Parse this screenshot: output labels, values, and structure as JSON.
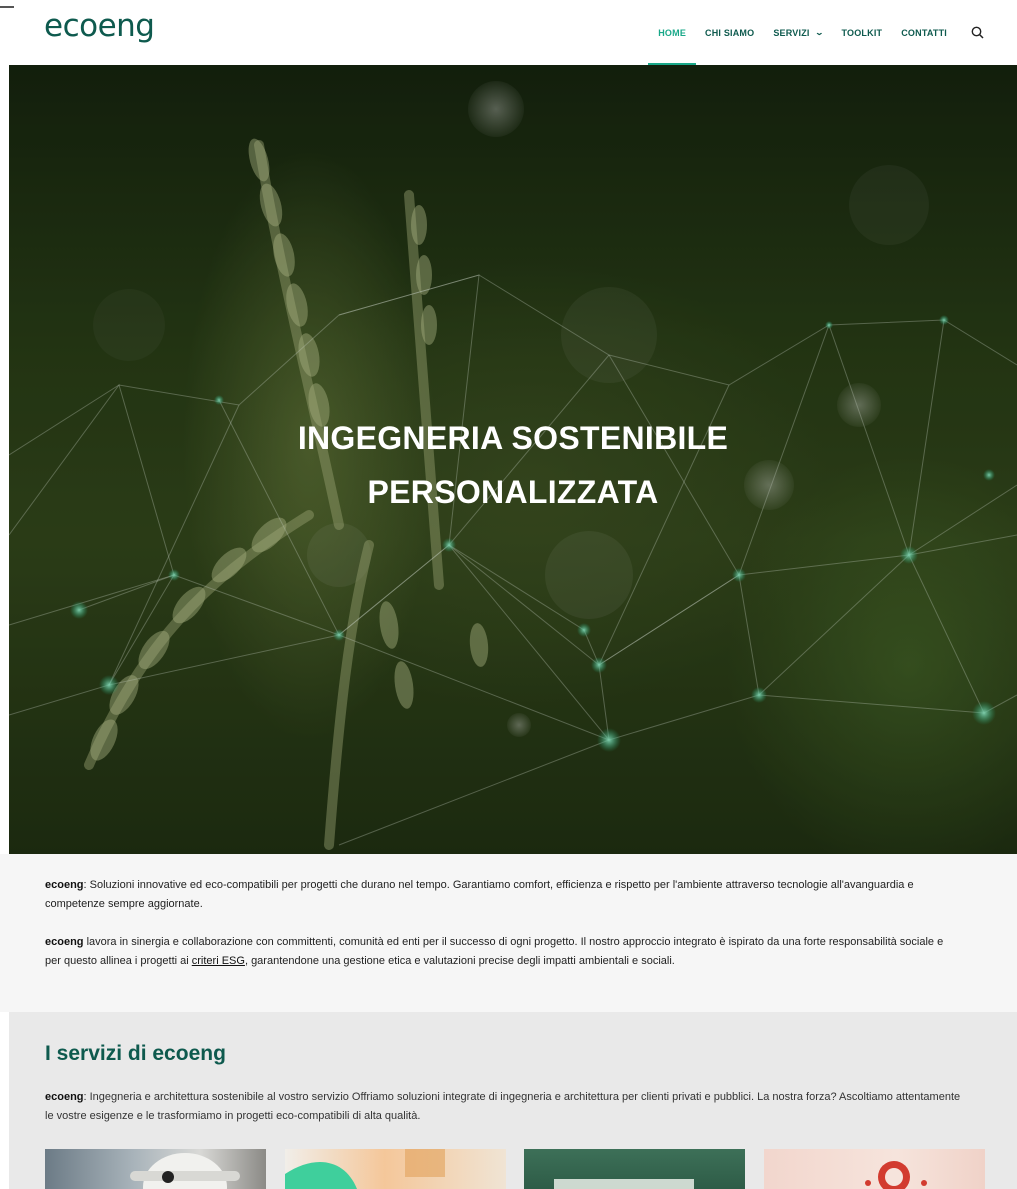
{
  "header": {
    "logo": "ecoeng",
    "nav": [
      {
        "label": "HOME",
        "active": true
      },
      {
        "label": "CHI SIAMO",
        "active": false
      },
      {
        "label": "SERVIZI",
        "active": false,
        "has_dropdown": true
      },
      {
        "label": "TOOLKIT",
        "active": false
      },
      {
        "label": "CONTATTI",
        "active": false
      }
    ],
    "search_icon": "search-icon"
  },
  "hero": {
    "title_line1": "INGEGNERIA SOSTENIBILE",
    "title_line2": "PERSONALIZZATA"
  },
  "intro": {
    "p1_brand": "ecoeng",
    "p1_text": ": Soluzioni innovative ed eco-compatibili per progetti che durano nel tempo. Garantiamo comfort, efficienza e rispetto per l'ambiente attraverso tecnologie all'avanguardia e competenze sempre aggiornate.",
    "p2_brand": "ecoeng",
    "p2_text_before": " lavora in sinergia e collaborazione con committenti, comunità ed enti per il successo di ogni progetto. Il nostro approccio integrato è ispirato da una forte responsabilità sociale e per questo allinea i progetti ai ",
    "p2_link": "criteri ESG",
    "p2_text_after": ", garantendone una gestione etica e valutazioni precise degli impatti ambientali e sociali."
  },
  "services": {
    "title": "I servizi di ecoeng",
    "desc_brand": "ecoeng",
    "desc_text": ": Ingegneria e architettura sostenibile al vostro servizio Offriamo soluzioni integrate di ingegneria e architettura per clienti privati e pubblici. La nostra forza? Ascoltiamo attentamente le vostre esigenze e le trasformiamo in progetti eco-compatibili di alta qualità."
  },
  "colors": {
    "brand": "#0e5a4e",
    "accent": "#19a889"
  }
}
